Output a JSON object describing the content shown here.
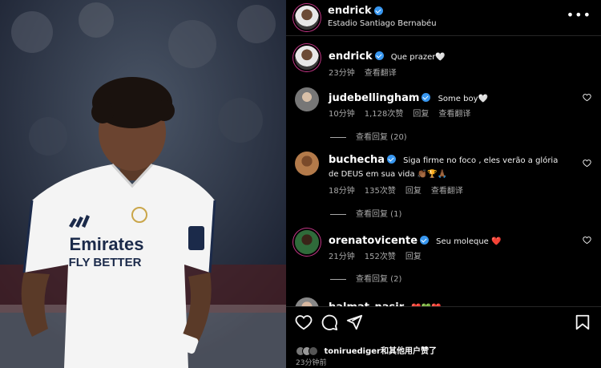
{
  "post": {
    "username": "endrick",
    "location": "Estadio Santiago Bernabéu",
    "caption": "Que prazer🤍",
    "caption_time": "23分钟",
    "caption_action": "查看翻译"
  },
  "photo": {
    "shirt_sponsor_line1": "Emirates",
    "shirt_sponsor_line2": "FLY BETTER"
  },
  "comments": [
    {
      "username": "judebellingham",
      "text": "Some boy🤍",
      "time": "10分钟",
      "likes": "1,128次赞",
      "reply": "回复",
      "translate": "查看翻译",
      "view_replies": "查看回复 (20)"
    },
    {
      "username": "buchecha",
      "text": "Siga firme no foco , eles verão a glória de DEUS em sua vida 👏🏾🏆🙏🏾",
      "time": "18分钟",
      "likes": "135次赞",
      "reply": "回复",
      "translate": "查看翻译",
      "view_replies": "查看回复 (1)"
    },
    {
      "username": "orenatovicente",
      "text": "Seu moleque ❤️",
      "time": "21分钟",
      "likes": "152次赞",
      "reply": "回复",
      "view_replies": "查看回复 (2)"
    },
    {
      "username": "halmat_nasir",
      "text": "❤️💚❤️"
    }
  ],
  "footer": {
    "liked_by": "toniruediger和其他用户赞了",
    "posted": "23分钟前"
  },
  "colors": {
    "verified": "#3897f0",
    "background": "#000000",
    "secondary_text": "#a8a8a8",
    "divider": "#262626"
  }
}
